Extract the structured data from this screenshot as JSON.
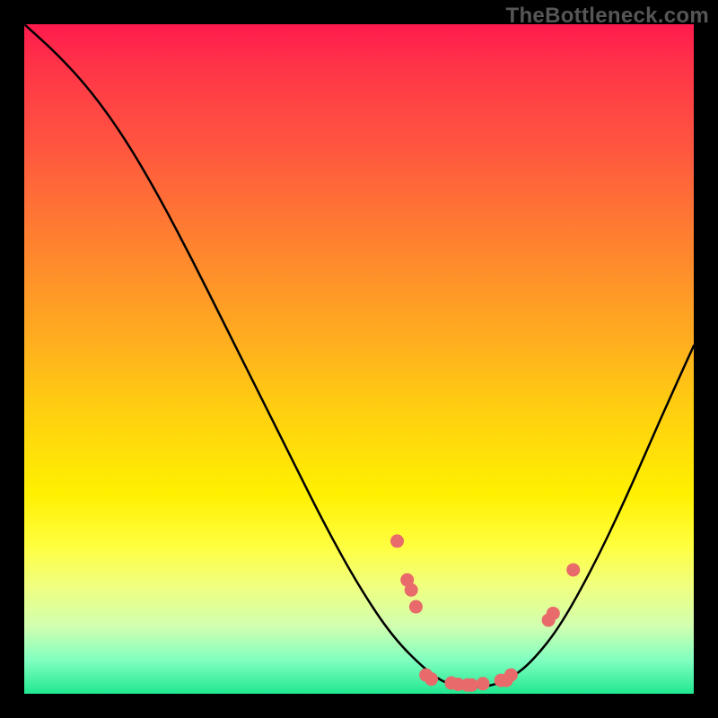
{
  "watermark": "TheBottleneck.com",
  "chart_data": {
    "type": "line",
    "title": "",
    "xlabel": "",
    "ylabel": "",
    "xlim": [
      0,
      100
    ],
    "ylim": [
      0,
      100
    ],
    "curve": [
      {
        "x": 0.0,
        "y": 100.0
      },
      {
        "x": 5.0,
        "y": 95.5
      },
      {
        "x": 10.0,
        "y": 90.0
      },
      {
        "x": 15.0,
        "y": 83.0
      },
      {
        "x": 20.0,
        "y": 74.5
      },
      {
        "x": 25.0,
        "y": 65.0
      },
      {
        "x": 30.0,
        "y": 55.0
      },
      {
        "x": 35.0,
        "y": 45.0
      },
      {
        "x": 40.0,
        "y": 35.0
      },
      {
        "x": 45.0,
        "y": 25.0
      },
      {
        "x": 50.0,
        "y": 16.0
      },
      {
        "x": 55.0,
        "y": 8.5
      },
      {
        "x": 60.0,
        "y": 3.5
      },
      {
        "x": 63.0,
        "y": 1.5
      },
      {
        "x": 66.0,
        "y": 0.8
      },
      {
        "x": 70.0,
        "y": 1.2
      },
      {
        "x": 73.0,
        "y": 2.5
      },
      {
        "x": 76.0,
        "y": 5.0
      },
      {
        "x": 80.0,
        "y": 10.0
      },
      {
        "x": 85.0,
        "y": 19.0
      },
      {
        "x": 90.0,
        "y": 29.5
      },
      {
        "x": 95.0,
        "y": 41.0
      },
      {
        "x": 100.0,
        "y": 52.0
      }
    ],
    "markers": [
      {
        "x": 55.7,
        "y": 22.8
      },
      {
        "x": 57.2,
        "y": 17.0
      },
      {
        "x": 57.8,
        "y": 15.5
      },
      {
        "x": 58.5,
        "y": 13.0
      },
      {
        "x": 60.0,
        "y": 2.8
      },
      {
        "x": 60.8,
        "y": 2.2
      },
      {
        "x": 63.8,
        "y": 1.6
      },
      {
        "x": 64.8,
        "y": 1.4
      },
      {
        "x": 66.2,
        "y": 1.3
      },
      {
        "x": 66.8,
        "y": 1.3
      },
      {
        "x": 68.5,
        "y": 1.5
      },
      {
        "x": 71.2,
        "y": 2.0
      },
      {
        "x": 72.0,
        "y": 2.0
      },
      {
        "x": 72.7,
        "y": 2.8
      },
      {
        "x": 78.3,
        "y": 11.0
      },
      {
        "x": 79.0,
        "y": 12.0
      },
      {
        "x": 82.0,
        "y": 18.5
      }
    ],
    "marker_color": "#e86a6a",
    "curve_color": "#000000"
  }
}
